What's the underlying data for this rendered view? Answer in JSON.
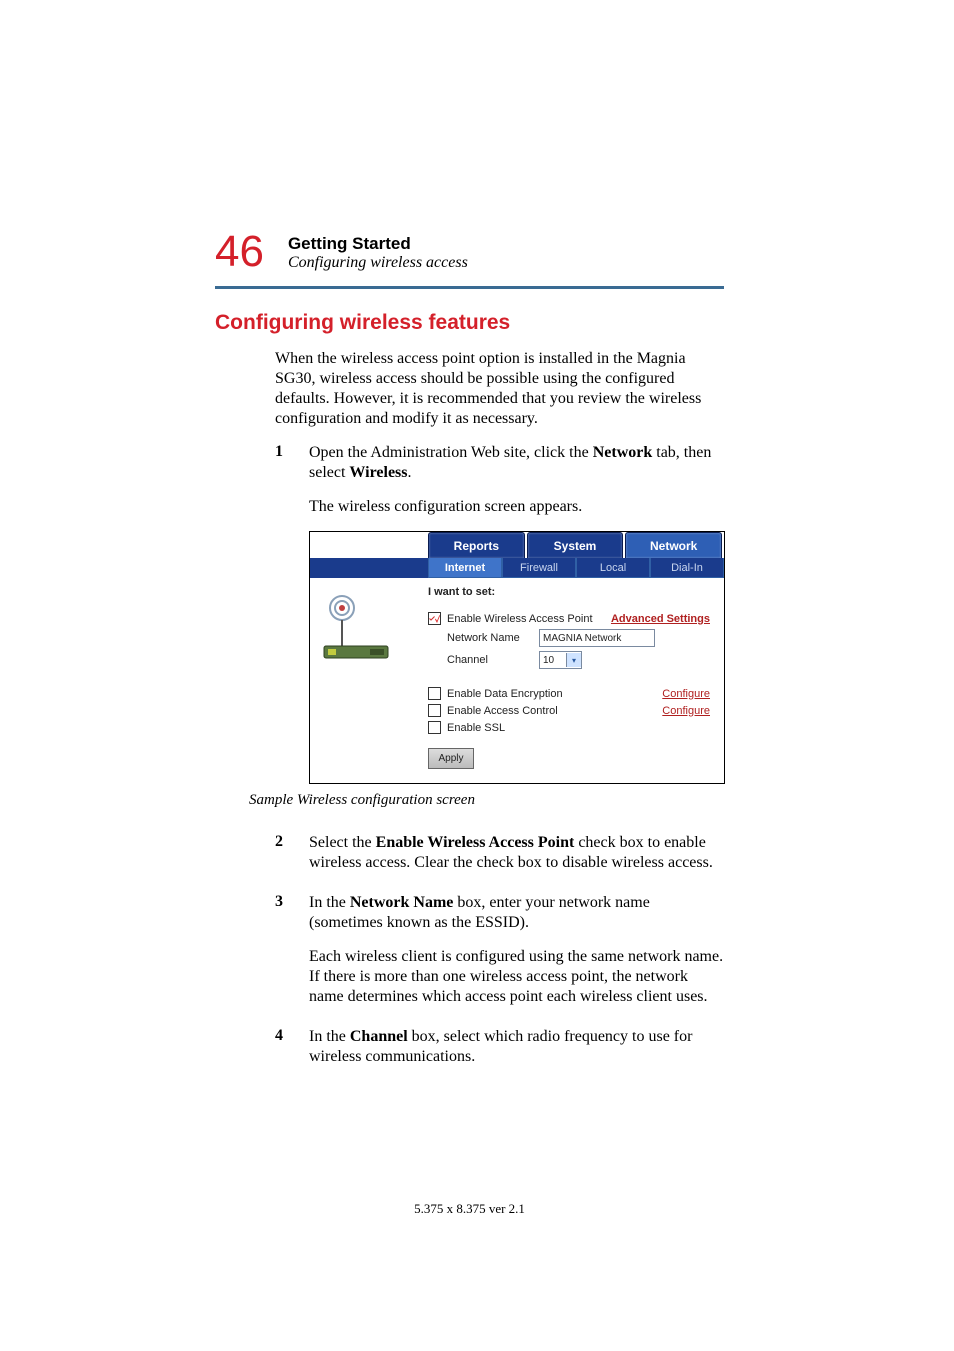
{
  "page_number": "46",
  "chapter_title": "Getting Started",
  "chapter_subtitle": "Configuring wireless access",
  "section_title": "Configuring wireless features",
  "intro": "When the wireless access point option is installed in the Magnia SG30, wireless access should be possible using the configured defaults. However, it is recommended that you review the wireless configuration and modify it as necessary.",
  "steps": {
    "s1_num": "1",
    "s1_a": "Open the Administration Web site, click the ",
    "s1_b": "Network",
    "s1_c": " tab, then select ",
    "s1_d": "Wireless",
    "s1_e": ".",
    "s1_note": "The wireless configuration screen appears.",
    "s2_num": "2",
    "s2_a": "Select the ",
    "s2_b": "Enable Wireless Access Point",
    "s2_c": " check box to enable wireless access. Clear the check box to disable wireless access.",
    "s3_num": "3",
    "s3_a": "In the ",
    "s3_b": "Network Name",
    "s3_c": " box, enter your network name (sometimes known as the ESSID).",
    "s3_note": "Each wireless client is configured using the same network name. If there is more than one wireless access point, the network name determines which access point each wireless client uses.",
    "s4_num": "4",
    "s4_a": "In the ",
    "s4_b": "Channel",
    "s4_c": " box, select which radio frequency to use for wireless communications."
  },
  "figure": {
    "tabs_main": {
      "reports": "Reports",
      "system": "System",
      "network": "Network"
    },
    "tabs_sub": {
      "internet": "Internet",
      "firewall": "Firewall",
      "local": "Local",
      "dialin": "Dial-In"
    },
    "lead": "I want to set:",
    "enable_wap": "Enable Wireless Access Point",
    "adv_settings": "Advanced Settings",
    "network_name_label": "Network Name",
    "network_name_value": "MAGNIA Network",
    "channel_label": "Channel",
    "channel_value": "10",
    "enable_encryption": "Enable Data Encryption",
    "enable_access_ctl": "Enable Access Control",
    "enable_ssl": "Enable SSL",
    "configure": "Configure",
    "apply": "Apply"
  },
  "caption": "Sample Wireless configuration screen",
  "footer": "5.375 x 8.375 ver 2.1"
}
